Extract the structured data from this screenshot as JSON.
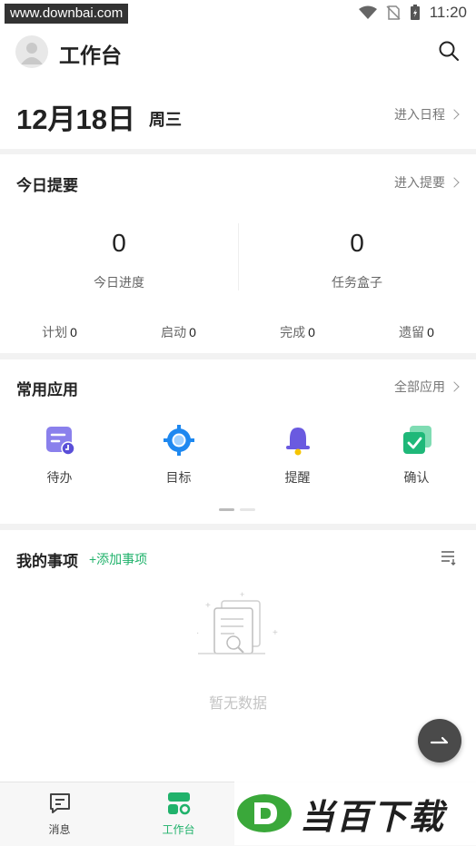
{
  "status_bar": {
    "watermark": "www.downbai.com",
    "time": "11:20"
  },
  "header": {
    "title": "工作台",
    "date": "12月18日",
    "weekday": "周三",
    "schedule_link": "进入日程"
  },
  "summary": {
    "title": "今日提要",
    "link": "进入提要",
    "progress": {
      "value": "0",
      "label": "今日进度"
    },
    "task_box": {
      "value": "0",
      "label": "任务盒子"
    },
    "stats": [
      {
        "label": "计划",
        "value": "0"
      },
      {
        "label": "启动",
        "value": "0"
      },
      {
        "label": "完成",
        "value": "0"
      },
      {
        "label": "遗留",
        "value": "0"
      }
    ]
  },
  "apps": {
    "title": "常用应用",
    "link": "全部应用",
    "items": [
      {
        "label": "待办",
        "icon": "todo-icon"
      },
      {
        "label": "目标",
        "icon": "target-icon"
      },
      {
        "label": "提醒",
        "icon": "bell-icon"
      },
      {
        "label": "确认",
        "icon": "confirm-icon"
      }
    ]
  },
  "my_items": {
    "title": "我的事项",
    "add": "+添加事项",
    "empty": "暂无数据"
  },
  "bottom_nav": [
    {
      "label": "消息",
      "icon": "message-icon"
    },
    {
      "label": "工作台",
      "icon": "workbench-icon",
      "active": true
    }
  ],
  "brand_watermark": {
    "text": "当百下载"
  },
  "colors": {
    "accent": "#20b26b",
    "target_blue": "#1e88f0",
    "todo_purple": "#7a6fe8",
    "bell_purple": "#6a5ae0"
  }
}
